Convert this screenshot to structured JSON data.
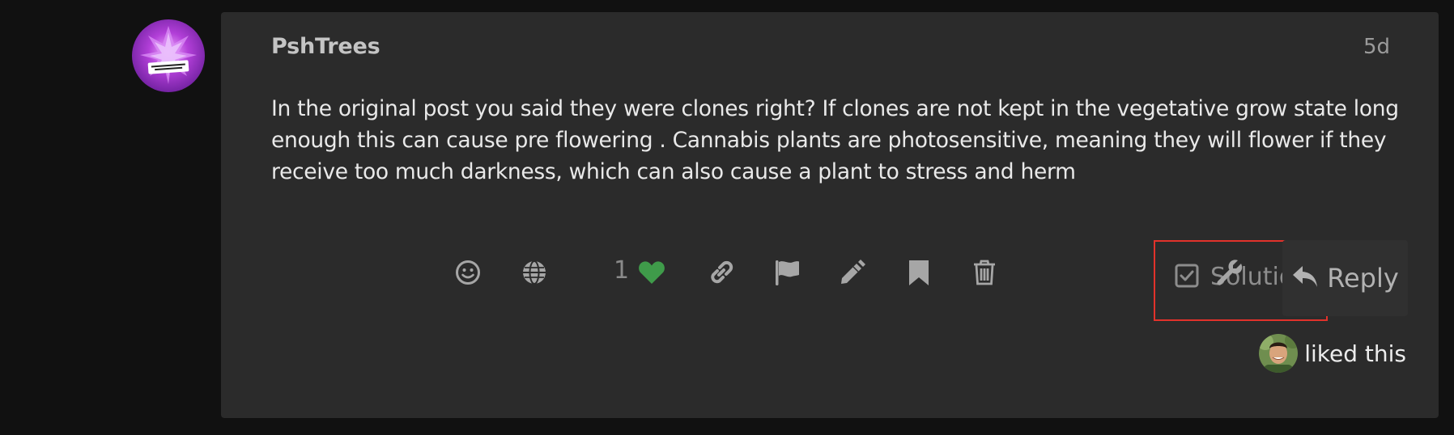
{
  "post": {
    "username": "PshTrees",
    "age": "5d",
    "body": "In the original post you said they were clones right? If clones are not kept in the vegetative grow state long enough this can cause pre flowering . Cannabis plants are photosensitive, meaning they will flower if they receive too much darkness, which can also cause a plant to stress and herm"
  },
  "actions": {
    "like_count": "1",
    "solution_label": "Solution",
    "reply_label": "Reply",
    "icons": [
      "smile-icon",
      "globe-icon",
      "heart-icon",
      "link-icon",
      "flag-icon",
      "pencil-icon",
      "bookmark-icon",
      "trash-icon",
      "checkbox-icon",
      "wrench-icon",
      "reply-icon"
    ],
    "highlight_color": "#e2322b",
    "heart_color": "#3f9b4a"
  },
  "liked_by": {
    "label": "liked this"
  }
}
